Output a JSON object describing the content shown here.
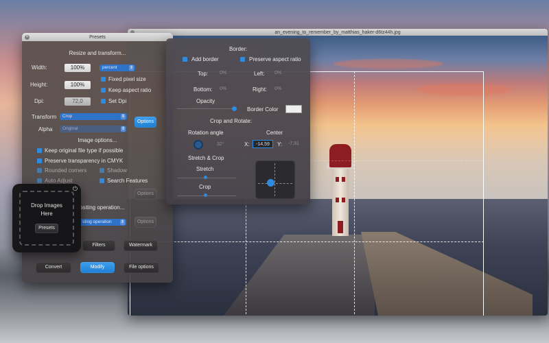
{
  "photo_window": {
    "title": "an_evening_to_remember_by_matthias_haker-d6tz44h.jpg"
  },
  "presets_panel": {
    "title": "Presets",
    "resize_heading": "Resize and transform...",
    "width_label": "Width:",
    "width_value": "100%",
    "width_unit": "percent",
    "height_label": "Height:",
    "height_value": "100%",
    "dpi_label": "Dpi:",
    "dpi_value": "72,0",
    "fixed_pixel_size": "Fixed pixel size",
    "keep_aspect_ratio": "Keep aspect ratio",
    "set_dpi": "Set Dpi",
    "transform_label": "Transform",
    "transform_value": "Crop",
    "options_button": "Options",
    "alpha_label": "Alpha",
    "alpha_value": "Original",
    "image_options_heading": "Image options...",
    "keep_original_type": "Keep original file type if possible",
    "preserve_transparency": "Preserve transparency in CMYK",
    "rounded_corners": "Rounded corners",
    "shadow": "Shadow",
    "auto_adjust": "Auto Adjust",
    "search_features": "Search Features",
    "options_button_2": "Options",
    "compositing_heading": "ositing operation...",
    "compositing_value": "sting operation",
    "options_button_3": "Options",
    "filters_button": "Filters",
    "watermark_button": "Watermark",
    "convert_button": "Convert",
    "modify_button": "Modify",
    "file_options_button": "File options"
  },
  "drop_widget": {
    "text_line1": "Drop Images",
    "text_line2": "Here",
    "presets_button": "Presets",
    "power_icon": "power-icon"
  },
  "options_panel": {
    "border_heading": "Border:",
    "add_border": "Add border",
    "preserve_aspect_ratio": "Preserve aspect ratio",
    "top_label": "Top:",
    "top_value": "0%",
    "left_label": "Left:",
    "left_value": "0%",
    "bottom_label": "Bottom:",
    "bottom_value": "0%",
    "right_label": "Right:",
    "right_value": "0%",
    "opacity_label": "Opacity",
    "border_color_label": "Border Color",
    "crop_rotate_heading": "Crop and Rotate:",
    "rotation_angle_label": "Rotation angle",
    "rotation_value": "32°",
    "center_label": "Center",
    "x_label": "X:",
    "x_value": "-14,59",
    "y_label": "Y:",
    "y_value": "-7,91",
    "stretch_crop_heading": "Stretch & Crop",
    "stretch_label": "Stretch",
    "crop_label": "Crop"
  }
}
